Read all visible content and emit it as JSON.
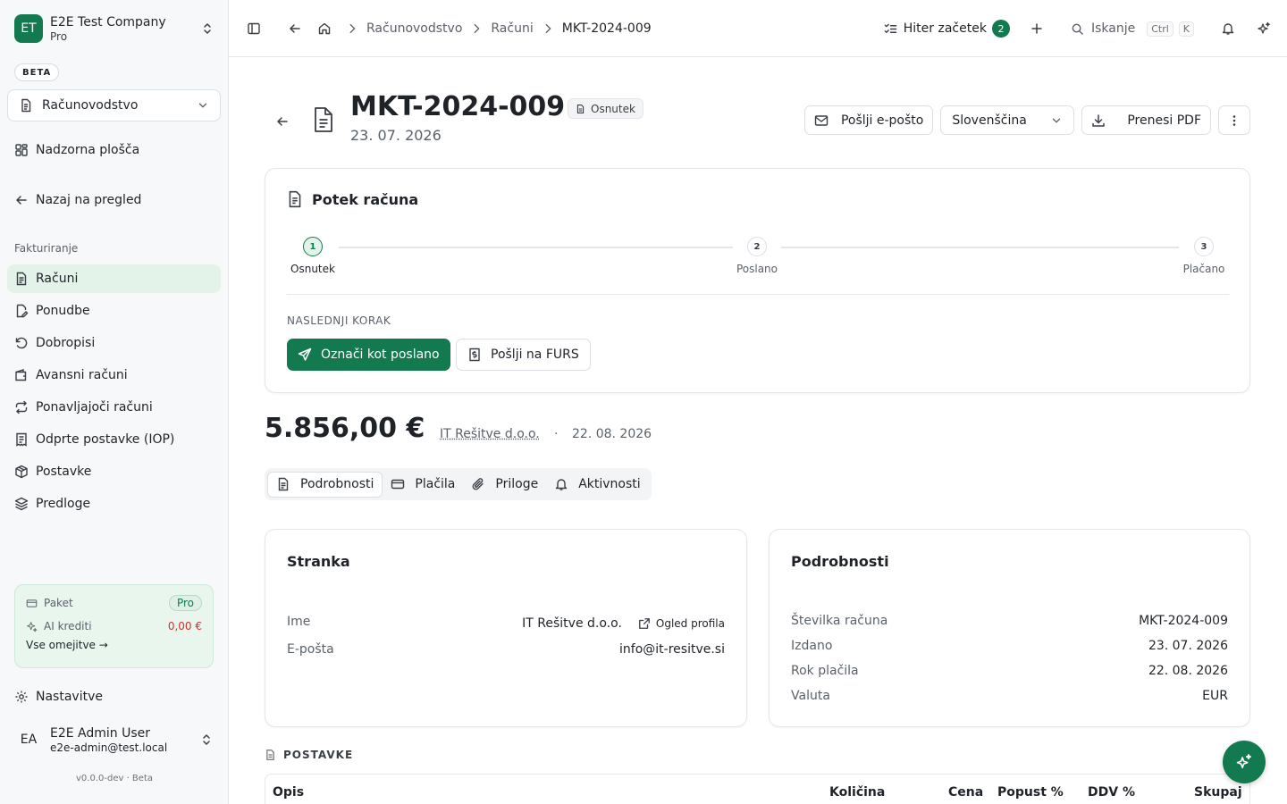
{
  "sidebar": {
    "company": {
      "initials": "ET",
      "name": "E2E Test Company",
      "plan": "Pro"
    },
    "beta_label": "BETA",
    "module": "Računovodstvo",
    "dashboard": "Nadzorna plošča",
    "back_to_overview": "Nazaj na pregled",
    "section": "Fakturiranje",
    "items": [
      {
        "label": "Računi",
        "icon": "file-text-icon",
        "active": true
      },
      {
        "label": "Ponudbe",
        "icon": "file-signature-icon"
      },
      {
        "label": "Dobropisi",
        "icon": "rotate-ccw-icon"
      },
      {
        "label": "Avansni računi",
        "icon": "wallet-icon"
      },
      {
        "label": "Ponavljajoči računi",
        "icon": "repeat-icon"
      },
      {
        "label": "Odprte postavke (IOP)",
        "icon": "receipt-icon"
      },
      {
        "label": "Postavke",
        "icon": "package-icon"
      },
      {
        "label": "Predloge",
        "icon": "layers-icon"
      }
    ],
    "plan_card": {
      "package_label": "Paket",
      "package_value": "Pro",
      "credits_label": "AI krediti",
      "credits_value": "0,00 €",
      "limits_link": "Vse omejitve →"
    },
    "settings": "Nastavitve",
    "user": {
      "initials": "EA",
      "name": "E2E Admin User",
      "email": "e2e-admin@test.local"
    },
    "version": "v0.0.0-dev · Beta"
  },
  "topbar": {
    "breadcrumbs": [
      "Računovodstvo",
      "Računi",
      "MKT-2024-009"
    ],
    "quick_start": "Hiter začetek",
    "quick_start_count": "2",
    "search": "Iskanje",
    "kbd_ctrl": "Ctrl",
    "kbd_k": "K"
  },
  "invoice": {
    "number": "MKT-2024-009",
    "status": "Osnutek",
    "date": "23. 07. 2026",
    "actions": {
      "email": "Pošlji e-pošto",
      "language": "Slovenščina",
      "pdf": "Prenesi PDF"
    },
    "flow": {
      "title": "Potek računa",
      "steps": [
        {
          "num": "1",
          "label": "Osnutek",
          "active": true
        },
        {
          "num": "2",
          "label": "Poslano"
        },
        {
          "num": "3",
          "label": "Plačano"
        }
      ],
      "next_label": "NASLEDNJI KORAK",
      "mark_sent": "Označi kot poslano",
      "send_furs": "Pošlji na FURS"
    },
    "summary": {
      "amount": "5.856,00 €",
      "client": "IT Rešitve d.o.o.",
      "separator": "·",
      "due": "22. 08. 2026"
    },
    "tabs": [
      {
        "label": "Podrobnosti",
        "active": true
      },
      {
        "label": "Plačila"
      },
      {
        "label": "Priloge"
      },
      {
        "label": "Aktivnosti"
      }
    ],
    "client_card": {
      "title": "Stranka",
      "name_label": "Ime",
      "name_value": "IT Rešitve d.o.o.",
      "profile_link": "Ogled profila",
      "email_label": "E-pošta",
      "email_value": "info@it-resitve.si"
    },
    "details_card": {
      "title": "Podrobnosti",
      "rows": [
        {
          "label": "Številka računa",
          "value": "MKT-2024-009"
        },
        {
          "label": "Izdano",
          "value": "23. 07. 2026"
        },
        {
          "label": "Rok plačila",
          "value": "22. 08. 2026"
        },
        {
          "label": "Valuta",
          "value": "EUR"
        }
      ]
    },
    "items_section": {
      "title": "POSTAVKE",
      "columns": [
        "Opis",
        "Količina",
        "Cena",
        "Popust %",
        "DDV %",
        "Skupaj"
      ]
    }
  },
  "colors": {
    "brand": "#137a4f",
    "active_bg": "#e3f3ea",
    "negative": "#d0312d"
  }
}
